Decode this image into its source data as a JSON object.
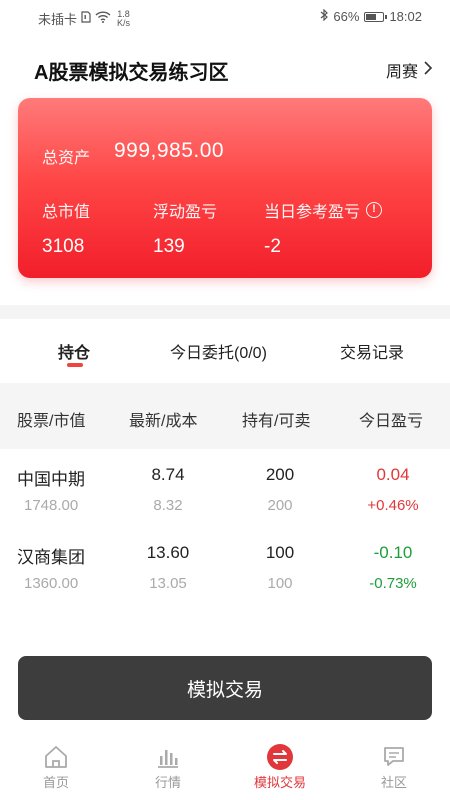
{
  "status_bar": {
    "carrier": "未插卡",
    "net_speed_value": "1.8",
    "net_speed_unit": "K/s",
    "battery_percent": "66%",
    "battery_level": 0.66,
    "time": "18:02"
  },
  "header": {
    "title": "A股票模拟交易练习区",
    "weekly_label": "周赛"
  },
  "account": {
    "total_assets_label": "总资产",
    "total_assets_value": "999,985.00",
    "market_value_label": "总市值",
    "market_value": "3108",
    "floating_pl_label": "浮动盈亏",
    "floating_pl": "139",
    "today_pl_label": "当日参考盈亏",
    "today_pl": "-2"
  },
  "tabs": [
    {
      "label": "持仓",
      "active": true
    },
    {
      "label": "今日委托(0/0)",
      "active": false
    },
    {
      "label": "交易记录",
      "active": false
    }
  ],
  "table": {
    "headers": [
      "股票/市值",
      "最新/成本",
      "持有/可卖",
      "今日盈亏"
    ],
    "rows": [
      {
        "name": "中国中期",
        "market_value": "1748.00",
        "latest": "8.74",
        "cost": "8.32",
        "hold": "200",
        "sellable": "200",
        "pl": "0.04",
        "pl_pct": "+0.46%",
        "trend": "up"
      },
      {
        "name": "汉商集团",
        "market_value": "1360.00",
        "latest": "13.60",
        "cost": "13.05",
        "hold": "100",
        "sellable": "100",
        "pl": "-0.10",
        "pl_pct": "-0.73%",
        "trend": "down"
      }
    ]
  },
  "trade_button": "模拟交易",
  "nav": [
    {
      "label": "首页",
      "icon": "home-icon"
    },
    {
      "label": "行情",
      "icon": "chart-icon"
    },
    {
      "label": "模拟交易",
      "icon": "exchange-icon",
      "active": true
    },
    {
      "label": "社区",
      "icon": "chat-icon"
    }
  ],
  "colors": {
    "accent": "#f0453f",
    "up": "#e2373a",
    "down": "#1e9e3a",
    "button": "#3d3d3d"
  }
}
